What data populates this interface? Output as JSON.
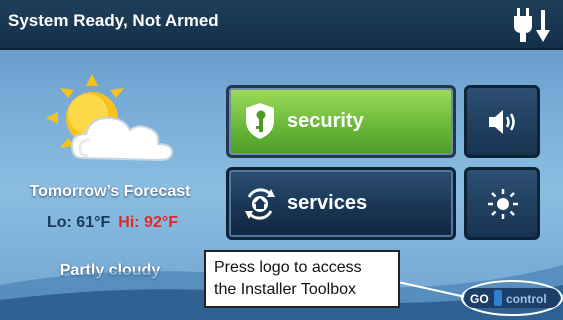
{
  "header": {
    "status": "System Ready, Not Armed",
    "power_icon": "power-plug-arrow-icon"
  },
  "weather": {
    "icon": "partly-cloudy-icon",
    "forecast_title": "Tomorrow’s Forecast",
    "lo": "Lo: 61°F",
    "hi": "Hi: 92°F",
    "condition": "Partly cloudy"
  },
  "buttons": {
    "security_label": "security",
    "services_label": "services",
    "volume_icon": "speaker-volume-icon",
    "brightness_icon": "brightness-sun-icon"
  },
  "callout": {
    "line1": "Press logo to access",
    "line2": "the Installer Toolbox"
  },
  "logo": {
    "text_left": "GO",
    "text_right": "control"
  },
  "colors": {
    "header_bg": "#143049",
    "security_green": "#6cb93a",
    "button_navy": "#1a3654",
    "hi_red": "#e12a2a",
    "lo_navy": "#163a5a"
  }
}
